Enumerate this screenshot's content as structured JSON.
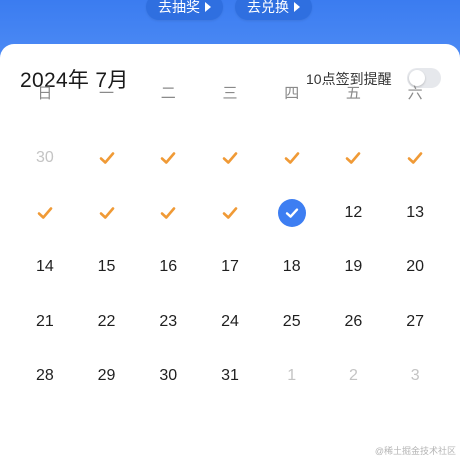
{
  "banner": {
    "lottery_label": "去抽奖",
    "exchange_label": "去兑换",
    "bg_color": "#3b7cf0"
  },
  "calendar": {
    "month_title": "2024年 7月",
    "remind_label": "10点签到提醒",
    "remind_enabled": false,
    "weekdays": [
      "日",
      "一",
      "二",
      "三",
      "四",
      "五",
      "六"
    ],
    "accent_color": "#3d7ef2",
    "check_color": "#f09a36",
    "weeks": [
      [
        {
          "label": "30",
          "state": "muted"
        },
        {
          "label": "",
          "state": "checked",
          "icon": "check-icon"
        },
        {
          "label": "",
          "state": "checked",
          "icon": "check-icon"
        },
        {
          "label": "",
          "state": "checked",
          "icon": "check-icon"
        },
        {
          "label": "",
          "state": "checked",
          "icon": "check-icon"
        },
        {
          "label": "",
          "state": "checked",
          "icon": "check-icon"
        },
        {
          "label": "",
          "state": "checked",
          "icon": "check-icon"
        }
      ],
      [
        {
          "label": "",
          "state": "checked",
          "icon": "check-icon"
        },
        {
          "label": "",
          "state": "checked",
          "icon": "check-icon"
        },
        {
          "label": "",
          "state": "checked",
          "icon": "check-icon"
        },
        {
          "label": "",
          "state": "checked",
          "icon": "check-icon"
        },
        {
          "label": "",
          "state": "today-checked",
          "icon": "today-check-icon"
        },
        {
          "label": "12",
          "state": "normal"
        },
        {
          "label": "13",
          "state": "normal"
        }
      ],
      [
        {
          "label": "14",
          "state": "normal"
        },
        {
          "label": "15",
          "state": "normal"
        },
        {
          "label": "16",
          "state": "normal"
        },
        {
          "label": "17",
          "state": "normal"
        },
        {
          "label": "18",
          "state": "normal"
        },
        {
          "label": "19",
          "state": "normal"
        },
        {
          "label": "20",
          "state": "normal"
        }
      ],
      [
        {
          "label": "21",
          "state": "normal"
        },
        {
          "label": "22",
          "state": "normal"
        },
        {
          "label": "23",
          "state": "normal"
        },
        {
          "label": "24",
          "state": "normal"
        },
        {
          "label": "25",
          "state": "normal"
        },
        {
          "label": "26",
          "state": "normal"
        },
        {
          "label": "27",
          "state": "normal"
        }
      ],
      [
        {
          "label": "28",
          "state": "normal"
        },
        {
          "label": "29",
          "state": "normal"
        },
        {
          "label": "30",
          "state": "normal"
        },
        {
          "label": "31",
          "state": "normal"
        },
        {
          "label": "1",
          "state": "muted"
        },
        {
          "label": "2",
          "state": "muted"
        },
        {
          "label": "3",
          "state": "muted"
        }
      ]
    ]
  },
  "watermark": "@稀土掘金技术社区"
}
